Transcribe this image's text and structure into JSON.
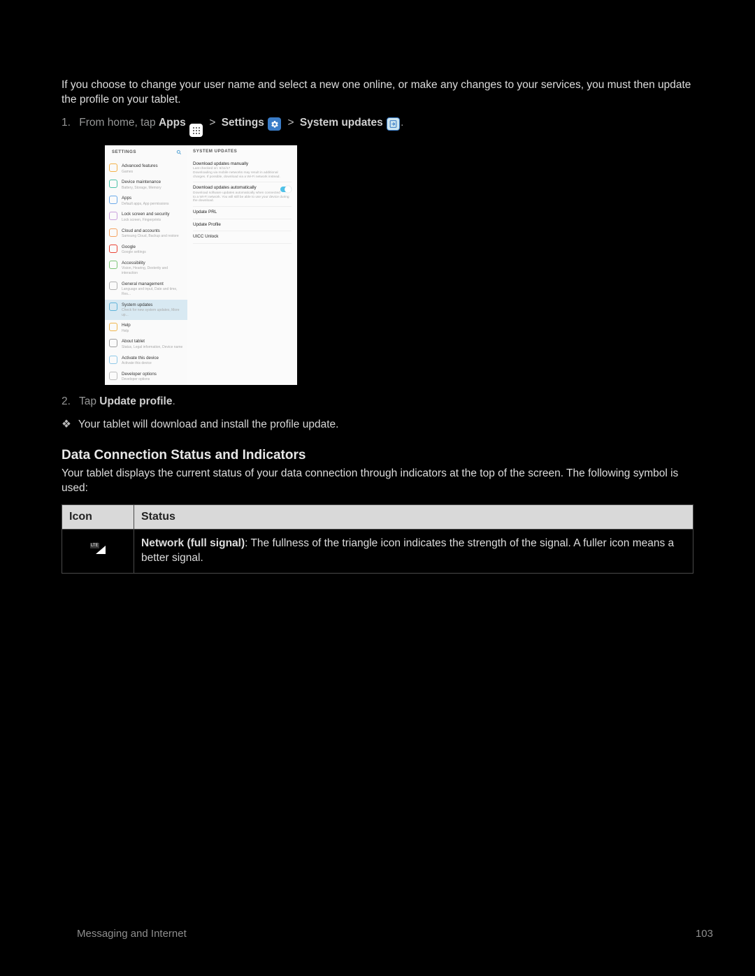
{
  "intro_text": "If you choose to change your user name and select a new one online, or make any changes to your services, you must then update the profile on your tablet.",
  "step1": {
    "num": "1.",
    "pre": "From home, tap ",
    "apps": "Apps",
    "settings": "Settings",
    "sysupd": "System updates",
    "gt": ">",
    "period": "."
  },
  "screenshot": {
    "left_title": "SETTINGS",
    "right_title": "SYSTEM UPDATES",
    "left_items": [
      {
        "t": "Advanced features",
        "s": "Games"
      },
      {
        "t": "Device maintenance",
        "s": "Battery, Storage, Memory"
      },
      {
        "t": "Apps",
        "s": "Default apps, App permissions"
      },
      {
        "t": "Lock screen and security",
        "s": "Lock screen, Fingerprints"
      },
      {
        "t": "Cloud and accounts",
        "s": "Samsung Cloud, Backup and restore"
      },
      {
        "t": "Google",
        "s": "Google settings"
      },
      {
        "t": "Accessibility",
        "s": "Vision, Hearing, Dexterity and interaction"
      },
      {
        "t": "General management",
        "s": "Language and input, Date and time, Res..."
      },
      {
        "t": "System updates",
        "s": "Check for new system updates, More up...",
        "sel": true
      },
      {
        "t": "Help",
        "s": "Help"
      },
      {
        "t": "About tablet",
        "s": "Status, Legal information, Device name"
      },
      {
        "t": "Activate this device",
        "s": "Activate this device"
      },
      {
        "t": "Developer options",
        "s": "Developer options"
      }
    ],
    "right_items": [
      {
        "t": "Download updates manually",
        "s": "Last checked on: 6/11/17\nDownloading via mobile networks may result in additional charges. If possible, download via a Wi-Fi network instead."
      },
      {
        "t": "Download updates automatically",
        "s": "Download software updates automatically when connected to a Wi-Fi network. You will still be able to use your device during the download.",
        "toggle": true
      },
      {
        "t": "Update PRL"
      },
      {
        "t": "Update Profile"
      },
      {
        "t": "UICC Unlock"
      }
    ]
  },
  "step2": {
    "num": "2.",
    "pre": "Tap ",
    "bold": "Update profile",
    "post": "."
  },
  "sub": "Your tablet will download and install the profile update.",
  "heading": "Data Connection Status and Indicators",
  "data_desc": "Your tablet displays the current status of your data connection through indicators at the top of the screen. The following symbol is used:",
  "table": {
    "h1": "Icon",
    "h2": "Status",
    "cell_bold": "Network (full signal)",
    "cell_rest": ": The fullness of the triangle icon indicates the strength of the signal. A fuller icon means a better signal.",
    "lte": "LTE"
  },
  "footer_left": "Messaging and Internet",
  "footer_right": "103"
}
